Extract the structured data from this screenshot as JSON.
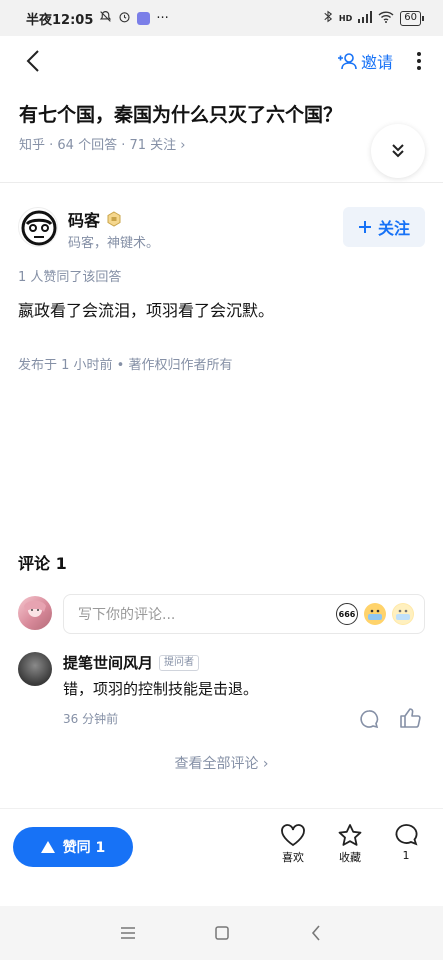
{
  "status_bar": {
    "time": "半夜12:05",
    "dots": "···",
    "signal": "HD",
    "battery": "60"
  },
  "top_nav": {
    "invite_label": "邀请"
  },
  "question": {
    "title": "有七个国，秦国为什么只灭了六个国？",
    "meta": "知乎 · 64 个回答 · 71 关注 ›"
  },
  "author": {
    "name": "码客",
    "bio": "码客，神键术。",
    "follow_label": "关注"
  },
  "answer": {
    "upvote_note": "1 人赞同了该回答",
    "body": "嬴政看了会流泪，项羽看了会沉默。",
    "publish_info": "发布于 1 小时前 • 著作权归作者所有"
  },
  "comments": {
    "title": "评论",
    "count": "1",
    "input_placeholder": "写下你的评论...",
    "emoji_labels": [
      "666",
      "",
      ""
    ],
    "items": [
      {
        "name": "提笔世间风月",
        "tag": "提问者",
        "text": "错，项羽的控制技能是击退。",
        "time": "36 分钟前"
      }
    ],
    "view_all": "查看全部评论 ›"
  },
  "bottom_bar": {
    "vote_label": "赞同 1",
    "like_label": "喜欢",
    "collect_label": "收藏",
    "comment_count": "1"
  },
  "colors": {
    "accent": "#1772f6",
    "muted": "#8590a6",
    "text": "#121212"
  }
}
